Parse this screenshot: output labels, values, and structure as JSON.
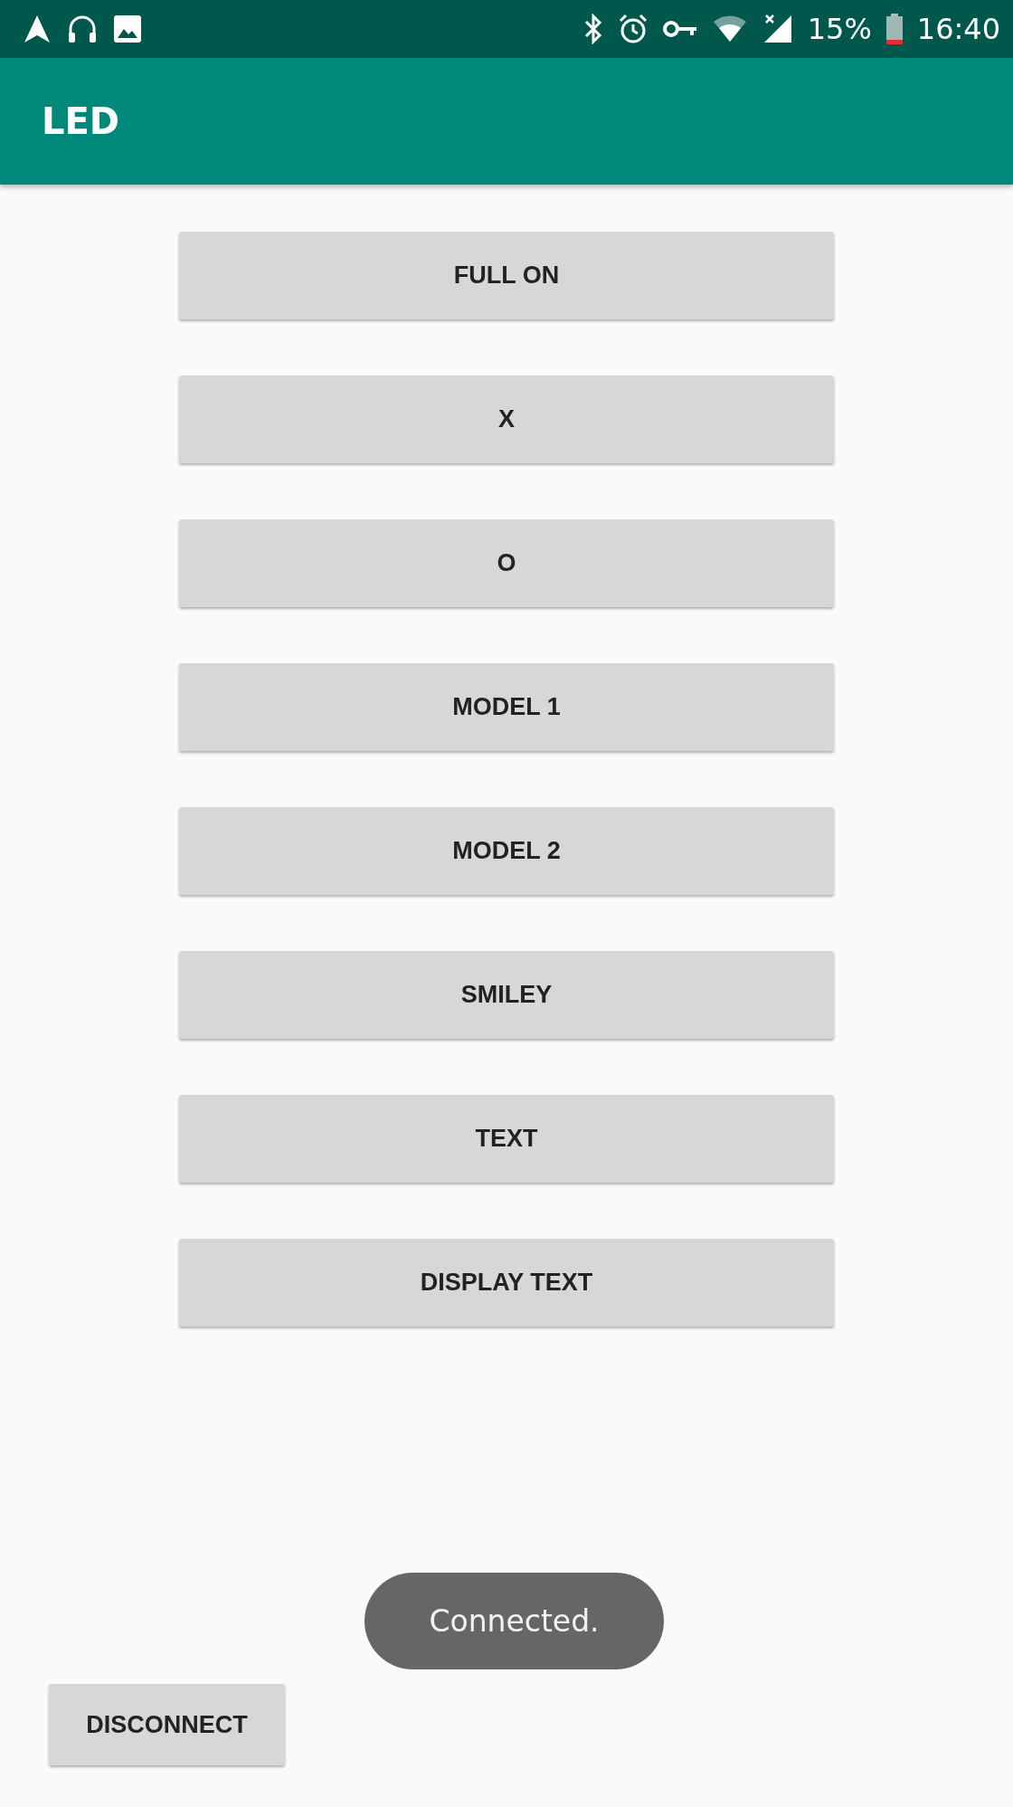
{
  "status_bar": {
    "battery": "15%",
    "time": "16:40"
  },
  "app_bar": {
    "title": "LED"
  },
  "buttons": [
    "FULL ON",
    "X",
    "O",
    "MODEL 1",
    "MODEL 2",
    "SMILEY",
    "TEXT",
    "DISPLAY TEXT"
  ],
  "toast": {
    "text": "Connected."
  },
  "disconnect_button": {
    "label": "DISCONNECT"
  }
}
